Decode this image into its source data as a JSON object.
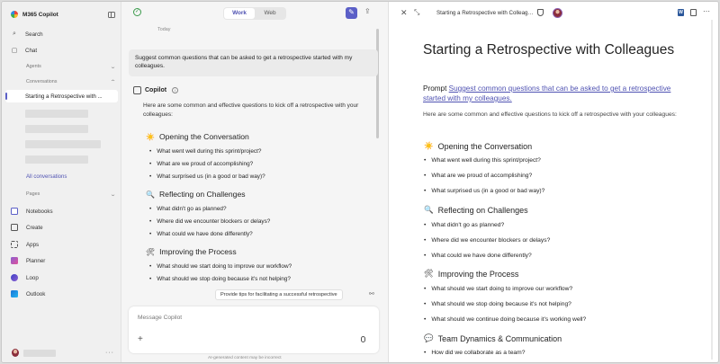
{
  "sidebar": {
    "app_title": "M365 Copilot",
    "search": "Search",
    "chat": "Chat",
    "agents": "Agents",
    "conversations": "Conversations",
    "active_conversation": "Starting a Retrospective with ...",
    "all_conversations": "All conversations",
    "pages": "Pages",
    "nav": [
      {
        "label": "Notebooks",
        "icon": "notebook-icon",
        "color": "#5b5fc7"
      },
      {
        "label": "Create",
        "icon": "create-icon",
        "color": "#555555"
      },
      {
        "label": "Apps",
        "icon": "apps-icon",
        "color": "#555555"
      },
      {
        "label": "Planner",
        "icon": "planner-icon",
        "color": "#8b5fd0"
      },
      {
        "label": "Loop",
        "icon": "loop-icon",
        "color": "#5b5fc7"
      },
      {
        "label": "Outlook",
        "icon": "outlook-icon",
        "color": "#1a73d8"
      }
    ]
  },
  "chat": {
    "toggle_work": "Work",
    "toggle_web": "Web",
    "today": "Today",
    "user_message": "Suggest common questions that can be asked to get a retrospective started with my colleagues.",
    "copilot_label": "Copilot",
    "intro": "Here are some common and effective questions to kick off a retrospective with your colleagues:",
    "sections": [
      {
        "emoji": "☀",
        "title": "Opening the Conversation",
        "items": [
          "What went well during this sprint/project?",
          "What are we proud of accomplishing?",
          "What surprised us (in a good or bad way)?"
        ]
      },
      {
        "emoji": "🔍",
        "title": "Reflecting on Challenges",
        "items": [
          "What didn't go as planned?",
          "Where did we encounter blockers or delays?",
          "What could we have done differently?"
        ]
      },
      {
        "emoji": "🛠",
        "title": "Improving the Process",
        "items": [
          "What should we start doing to improve our workflow?",
          "What should we stop doing because it's not helping?"
        ]
      }
    ],
    "suggestion": "Provide tips for facilitating a successful retrospective",
    "composer_placeholder": "Message Copilot",
    "disclaimer": "AI-generated content may be incorrect"
  },
  "doc": {
    "tab_title": "Starting a Retrospective with Colleagues",
    "heading": "Starting a Retrospective with Colleagues",
    "prompt_label": "Prompt",
    "prompt_link": "Suggest common questions that can be asked to get a retrospective started with my colleagues.",
    "intro": "Here are some common and effective questions to kick off a retrospective with your colleagues:",
    "sections": [
      {
        "emoji": "☀",
        "title": "Opening the Conversation",
        "items": [
          "What went well during this sprint/project?",
          "What are we proud of accomplishing?",
          "What surprised us (in a good or bad way)?"
        ]
      },
      {
        "emoji": "🔍",
        "title": "Reflecting on Challenges",
        "items": [
          "What didn't go as planned?",
          "Where did we encounter blockers or delays?",
          "What could we have done differently?"
        ]
      },
      {
        "emoji": "🛠",
        "title": "Improving the Process",
        "items": [
          "What should we start doing to improve our workflow?",
          "What should we stop doing because it's not helping?",
          "What should we continue doing because it's working well?"
        ]
      },
      {
        "emoji": "💬",
        "title": "Team Dynamics & Communication",
        "items": [
          "How did we collaborate as a team?"
        ]
      }
    ]
  },
  "colors": {
    "accent": "#5b5fc7",
    "link": "#4f52b2"
  }
}
